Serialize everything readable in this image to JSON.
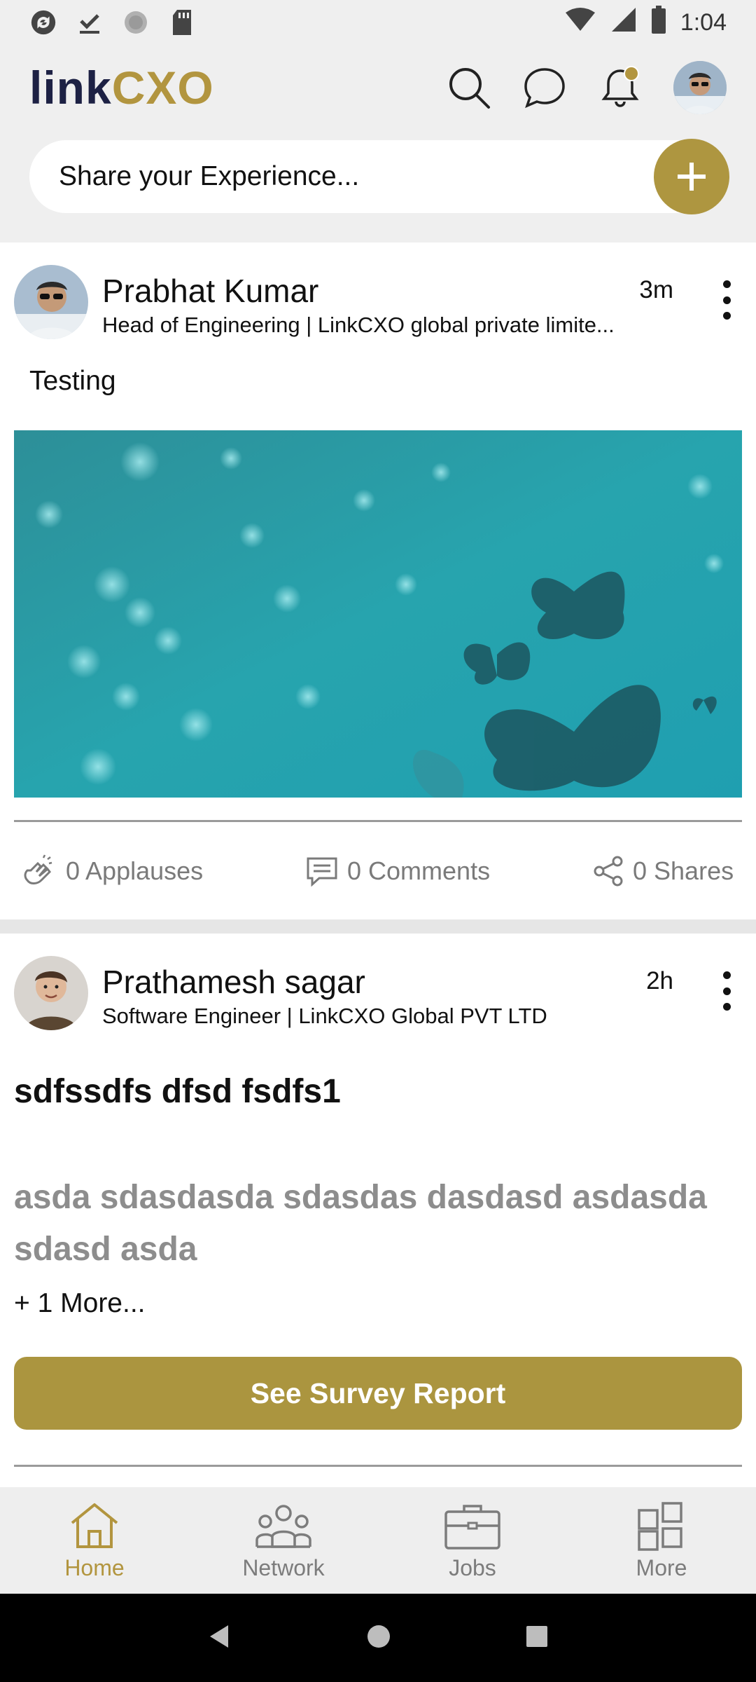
{
  "status_bar": {
    "time": "1:04",
    "icons": [
      "sync-icon",
      "download-done-icon",
      "loading-icon",
      "sd-card-icon",
      "wifi-icon",
      "cell-signal-icon",
      "battery-icon"
    ]
  },
  "header": {
    "logo_part1": "link",
    "logo_part2": "CXO",
    "icons": [
      "search-icon",
      "chat-icon",
      "bell-icon",
      "profile-avatar"
    ]
  },
  "share": {
    "placeholder": "Share your Experience...",
    "add_icon": "plus-icon"
  },
  "posts": [
    {
      "author": "Prabhat Kumar",
      "subtitle": "Head of Engineering | LinkCXO global private limite...",
      "time": "3m",
      "text": "Testing",
      "image": "teal-butterflies-image",
      "applauses": "0 Applauses",
      "comments": "0 Comments",
      "shares": "0 Shares"
    },
    {
      "author": "Prathamesh sagar",
      "subtitle": "Software  Engineer | LinkCXO Global PVT LTD",
      "time": "2h",
      "title": "sdfssdfs dfsd fsdfs1",
      "description": "asda sdasdasda sdasdas dasdasd asdasda sdasd asda",
      "more": "+ 1 More...",
      "button": "See Survey Report"
    }
  ],
  "bottom_nav": [
    {
      "label": "Home",
      "icon": "home-icon",
      "active": true
    },
    {
      "label": "Network",
      "icon": "network-icon",
      "active": false
    },
    {
      "label": "Jobs",
      "icon": "briefcase-icon",
      "active": false
    },
    {
      "label": "More",
      "icon": "grid-icon",
      "active": false
    }
  ],
  "colors": {
    "accent": "#ae9640",
    "logo_dark": "#1d2144",
    "background": "#efefef",
    "muted_text": "#7a7a7a"
  }
}
